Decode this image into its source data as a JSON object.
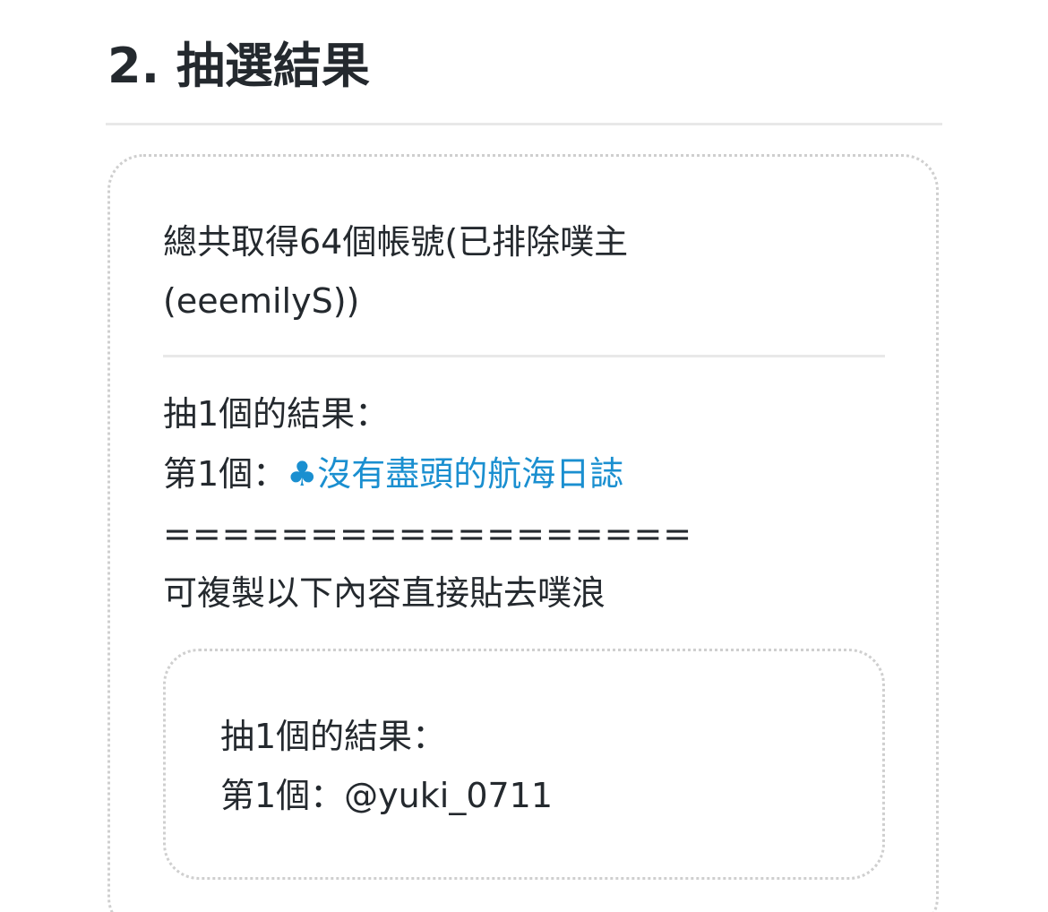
{
  "section": {
    "title": "2. 抽選結果"
  },
  "summary": {
    "line1": "總共取得64個帳號(已排除噗主",
    "line2": "(eeemilyS))"
  },
  "result": {
    "heading": "抽1個的結果：",
    "first_prefix": "第1個：",
    "first_icon": "♣",
    "first_winner_name": "沒有盡頭的航海日誌",
    "separator": "==================",
    "copy_hint": "可複製以下內容直接貼去噗浪"
  },
  "copy_box": {
    "line1": "抽1個的結果：",
    "line2": "第1個：@yuki_0711"
  },
  "colors": {
    "link": "#1a8fd0",
    "text": "#24292e",
    "rule": "#e8e8e8",
    "dotted_border": "#cfcfcf"
  }
}
